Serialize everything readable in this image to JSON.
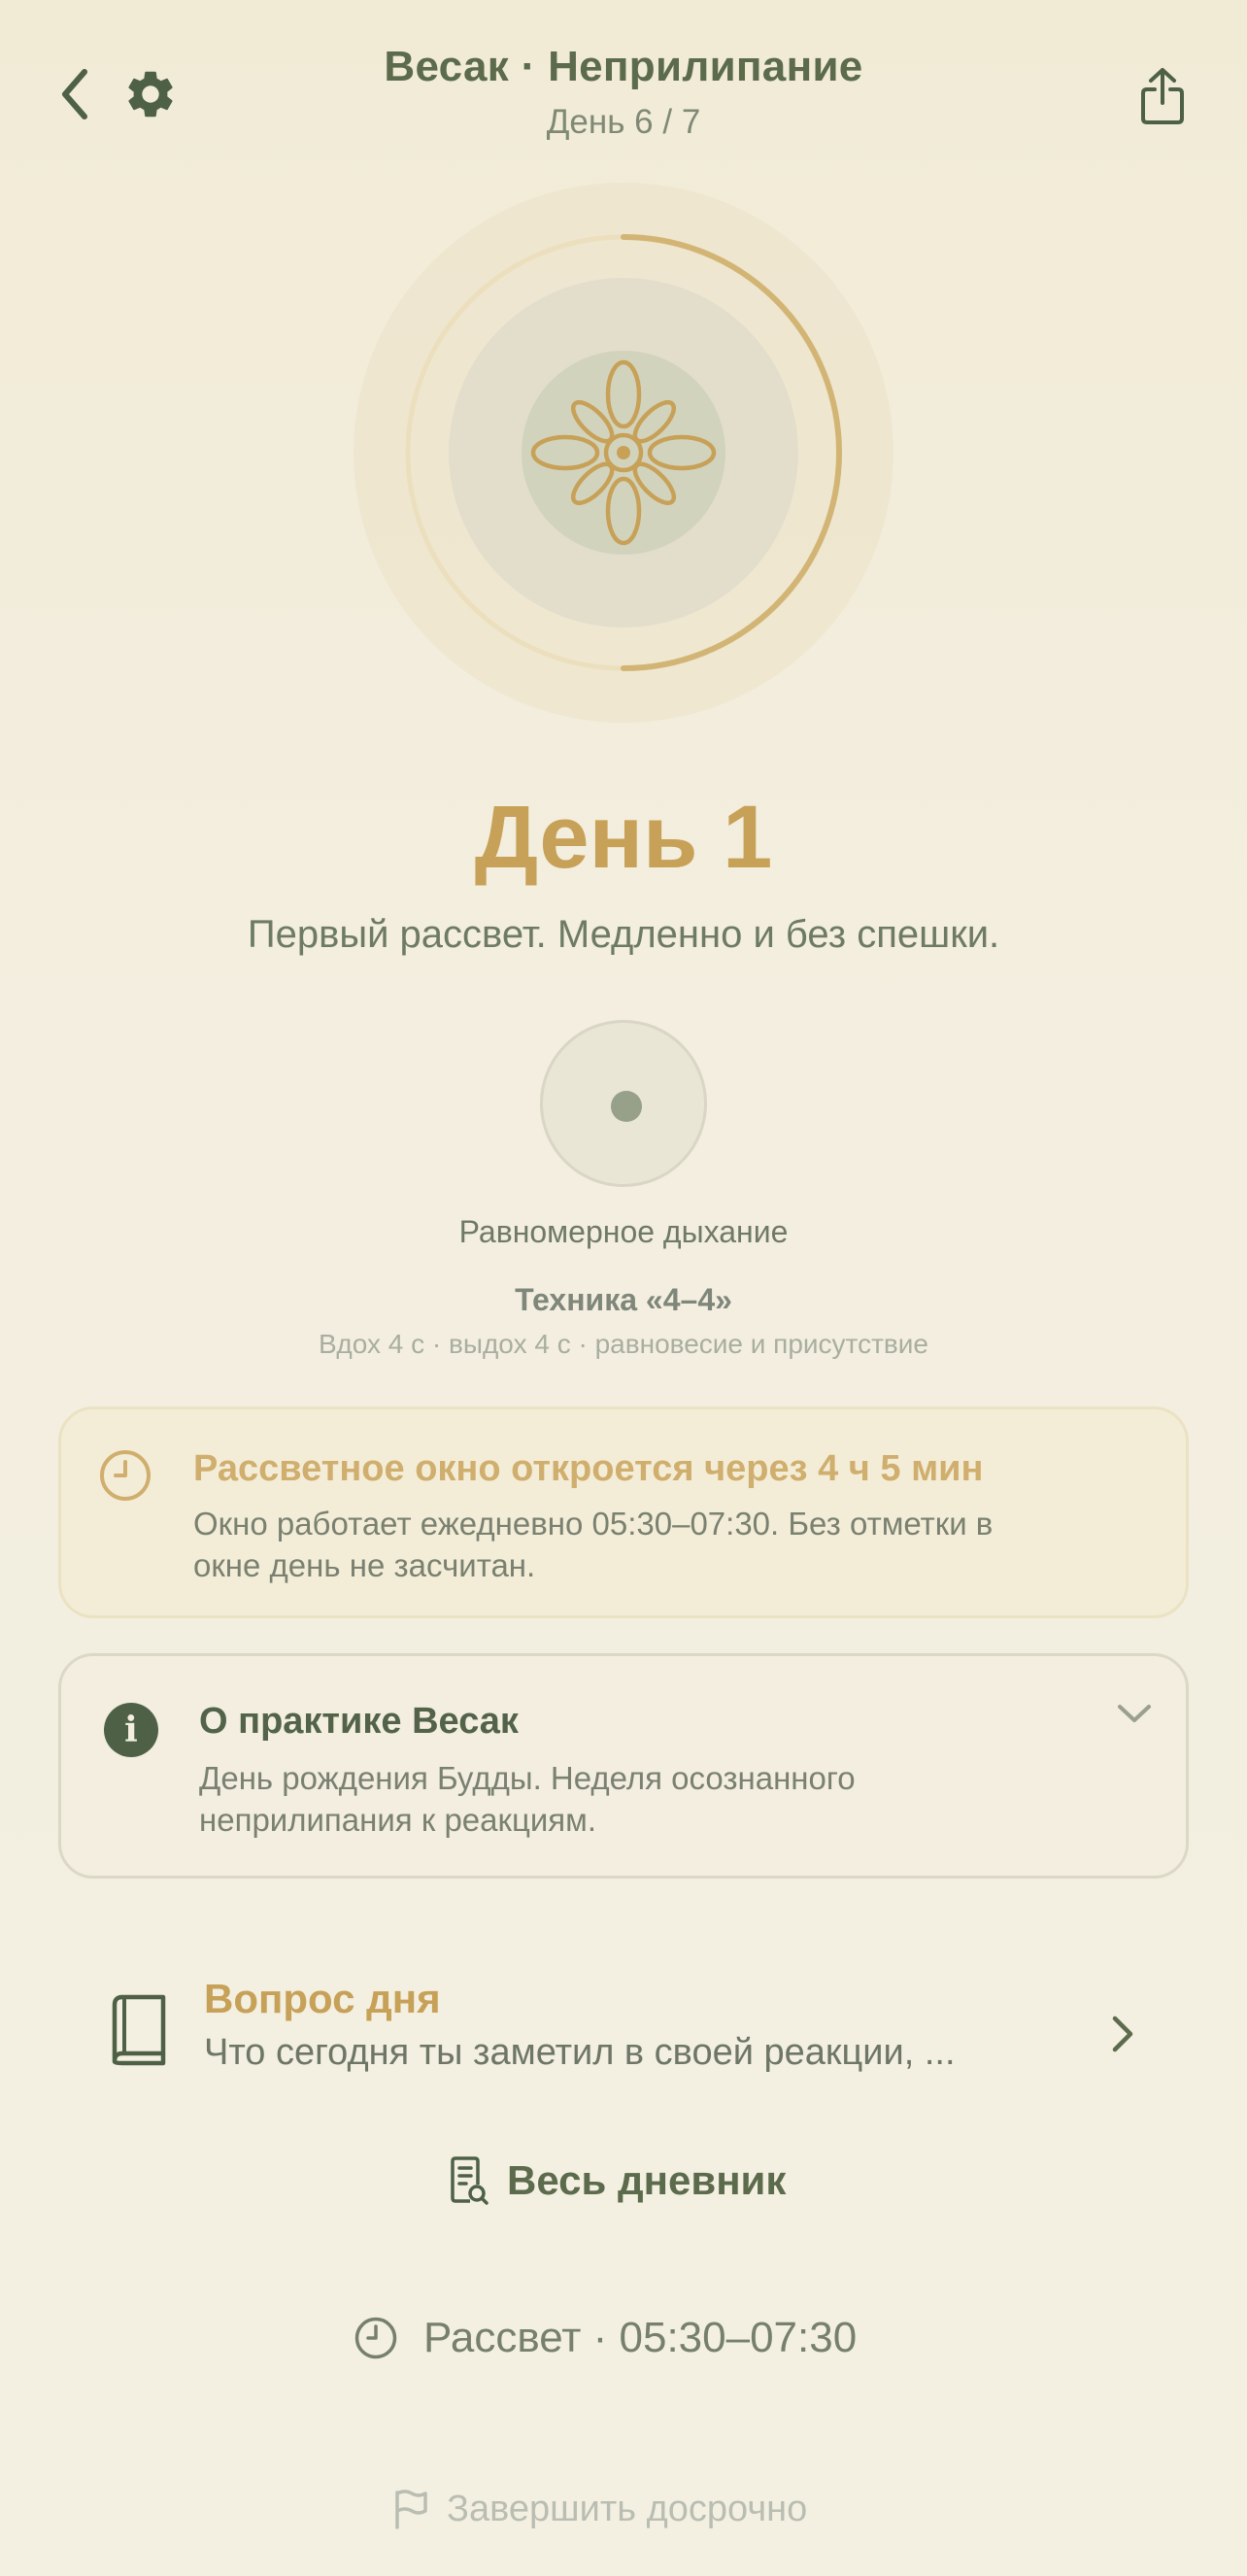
{
  "header": {
    "title": "Весак · Неприлипание",
    "subtitle": "День 6 / 7"
  },
  "day": {
    "title": "День 1",
    "subtitle": "Первый рассвет. Медленно и без спешки.",
    "progress_fraction": 0.5
  },
  "breathing": {
    "label": "Равномерное дыхание",
    "technique_title": "Техника «4–4»",
    "technique_desc": "Вдох 4 с · выдох 4 с · равновесие и присутствие"
  },
  "dawn_card": {
    "title": "Рассветное окно откроется через 4 ч 5 мин",
    "text": "Окно работает ежедневно 05:30–07:30. Без отметки в окне день не засчитан."
  },
  "info_card": {
    "title": "О практике Весак",
    "text": "День рождения Будды. Неделя осознанного неприлипания к реакциям.",
    "icon_glyph": "i"
  },
  "question": {
    "title": "Вопрос дня",
    "text": "Что сегодня ты заметил в своей реакции, ..."
  },
  "diary_label": "Весь дневник",
  "dawn_time_label": "Рассвет · 05:30–07:30",
  "finish_label": "Завершить досрочно",
  "colors": {
    "accent_gold": "#c7a157",
    "green_dark": "#4e6147",
    "background": "#f3eedf"
  }
}
